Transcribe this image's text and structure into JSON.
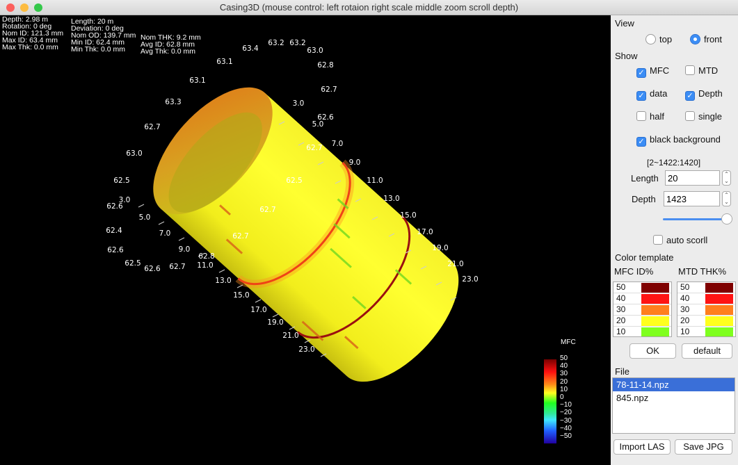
{
  "window": {
    "title": "Casing3D (mouse control: left rotaion right scale middle zoom scroll depth)"
  },
  "info": {
    "col1": [
      "Depth: 2.98 m",
      "Rotation: 0 deg",
      "Nom ID: 121.3 mm",
      "Max ID: 63.4 mm",
      "Max Thk: 0.0 mm"
    ],
    "col2": [
      "Length: 20 m",
      "Deviation: 0 deg",
      "Nom OD: 139.7 mm",
      "Min ID: 62.4 mm",
      "Min Thk: 0.0 mm"
    ],
    "col3": [
      "Nom THK: 9.2 mm",
      "Avg ID: 62.8 mm",
      "Avg Thk: 0.0 mm"
    ]
  },
  "plot": {
    "id_labels": [
      "63.4",
      "63.2",
      "63.2",
      "63.0",
      "62.8",
      "62.7",
      "62.6",
      "62.7",
      "62.5",
      "62.7",
      "62.7",
      "62.8",
      "62.7",
      "62.6",
      "62.5",
      "62.6",
      "62.4",
      "62.6",
      "62.5",
      "63.0",
      "62.7",
      "63.3",
      "63.1",
      "63.1"
    ],
    "depth_labels_right": [
      "3.0",
      "5.0",
      "7.0",
      "9.0",
      "11.0",
      "13.0",
      "15.0",
      "17.0",
      "19.0",
      "21.0",
      "23.0"
    ],
    "depth_labels_left": [
      "3.0",
      "5.0",
      "7.0",
      "9.0",
      "11.0",
      "13.0",
      "15.0",
      "17.0",
      "19.0",
      "21.0",
      "23.0"
    ],
    "colorbar": {
      "title": "MFC",
      "ticks": [
        "50",
        "40",
        "30",
        "20",
        "10",
        "0",
        "−10",
        "−20",
        "−30",
        "−40",
        "−50"
      ],
      "range": [
        -50,
        50
      ]
    }
  },
  "panel": {
    "view_label": "View",
    "view_options": [
      {
        "label": "top",
        "selected": false
      },
      {
        "label": "front",
        "selected": true
      }
    ],
    "show_label": "Show",
    "checks": [
      {
        "label": "MFC",
        "checked": true
      },
      {
        "label": "MTD",
        "checked": false
      },
      {
        "label": "data",
        "checked": true
      },
      {
        "label": "Depth",
        "checked": true
      },
      {
        "label": "half",
        "checked": false
      },
      {
        "label": "single",
        "checked": false
      },
      {
        "label": "black background",
        "checked": true
      }
    ],
    "range_text": "[2~1422:1420]",
    "length_label": "Length",
    "length_value": "20",
    "depth_label": "Depth",
    "depth_value": "1423",
    "depth_slider": 1.0,
    "auto_scroll_label": "auto scorll",
    "auto_scroll": false,
    "color_template_label": "Color template",
    "mfc_header": "MFC ID%",
    "mtd_header": "MTD THK%",
    "levels": [
      {
        "v": "50",
        "c": "#7f0000"
      },
      {
        "v": "40",
        "c": "#ff1414"
      },
      {
        "v": "30",
        "c": "#ff7f1e"
      },
      {
        "v": "20",
        "c": "#ffff1e"
      },
      {
        "v": "10",
        "c": "#7fff1e"
      }
    ],
    "ok_label": "OK",
    "default_label": "default",
    "file_label": "File",
    "files": [
      {
        "name": "78-11-14.npz",
        "selected": true
      },
      {
        "name": "845.npz",
        "selected": false
      }
    ],
    "import_label": "Import LAS",
    "save_label": "Save JPG"
  }
}
